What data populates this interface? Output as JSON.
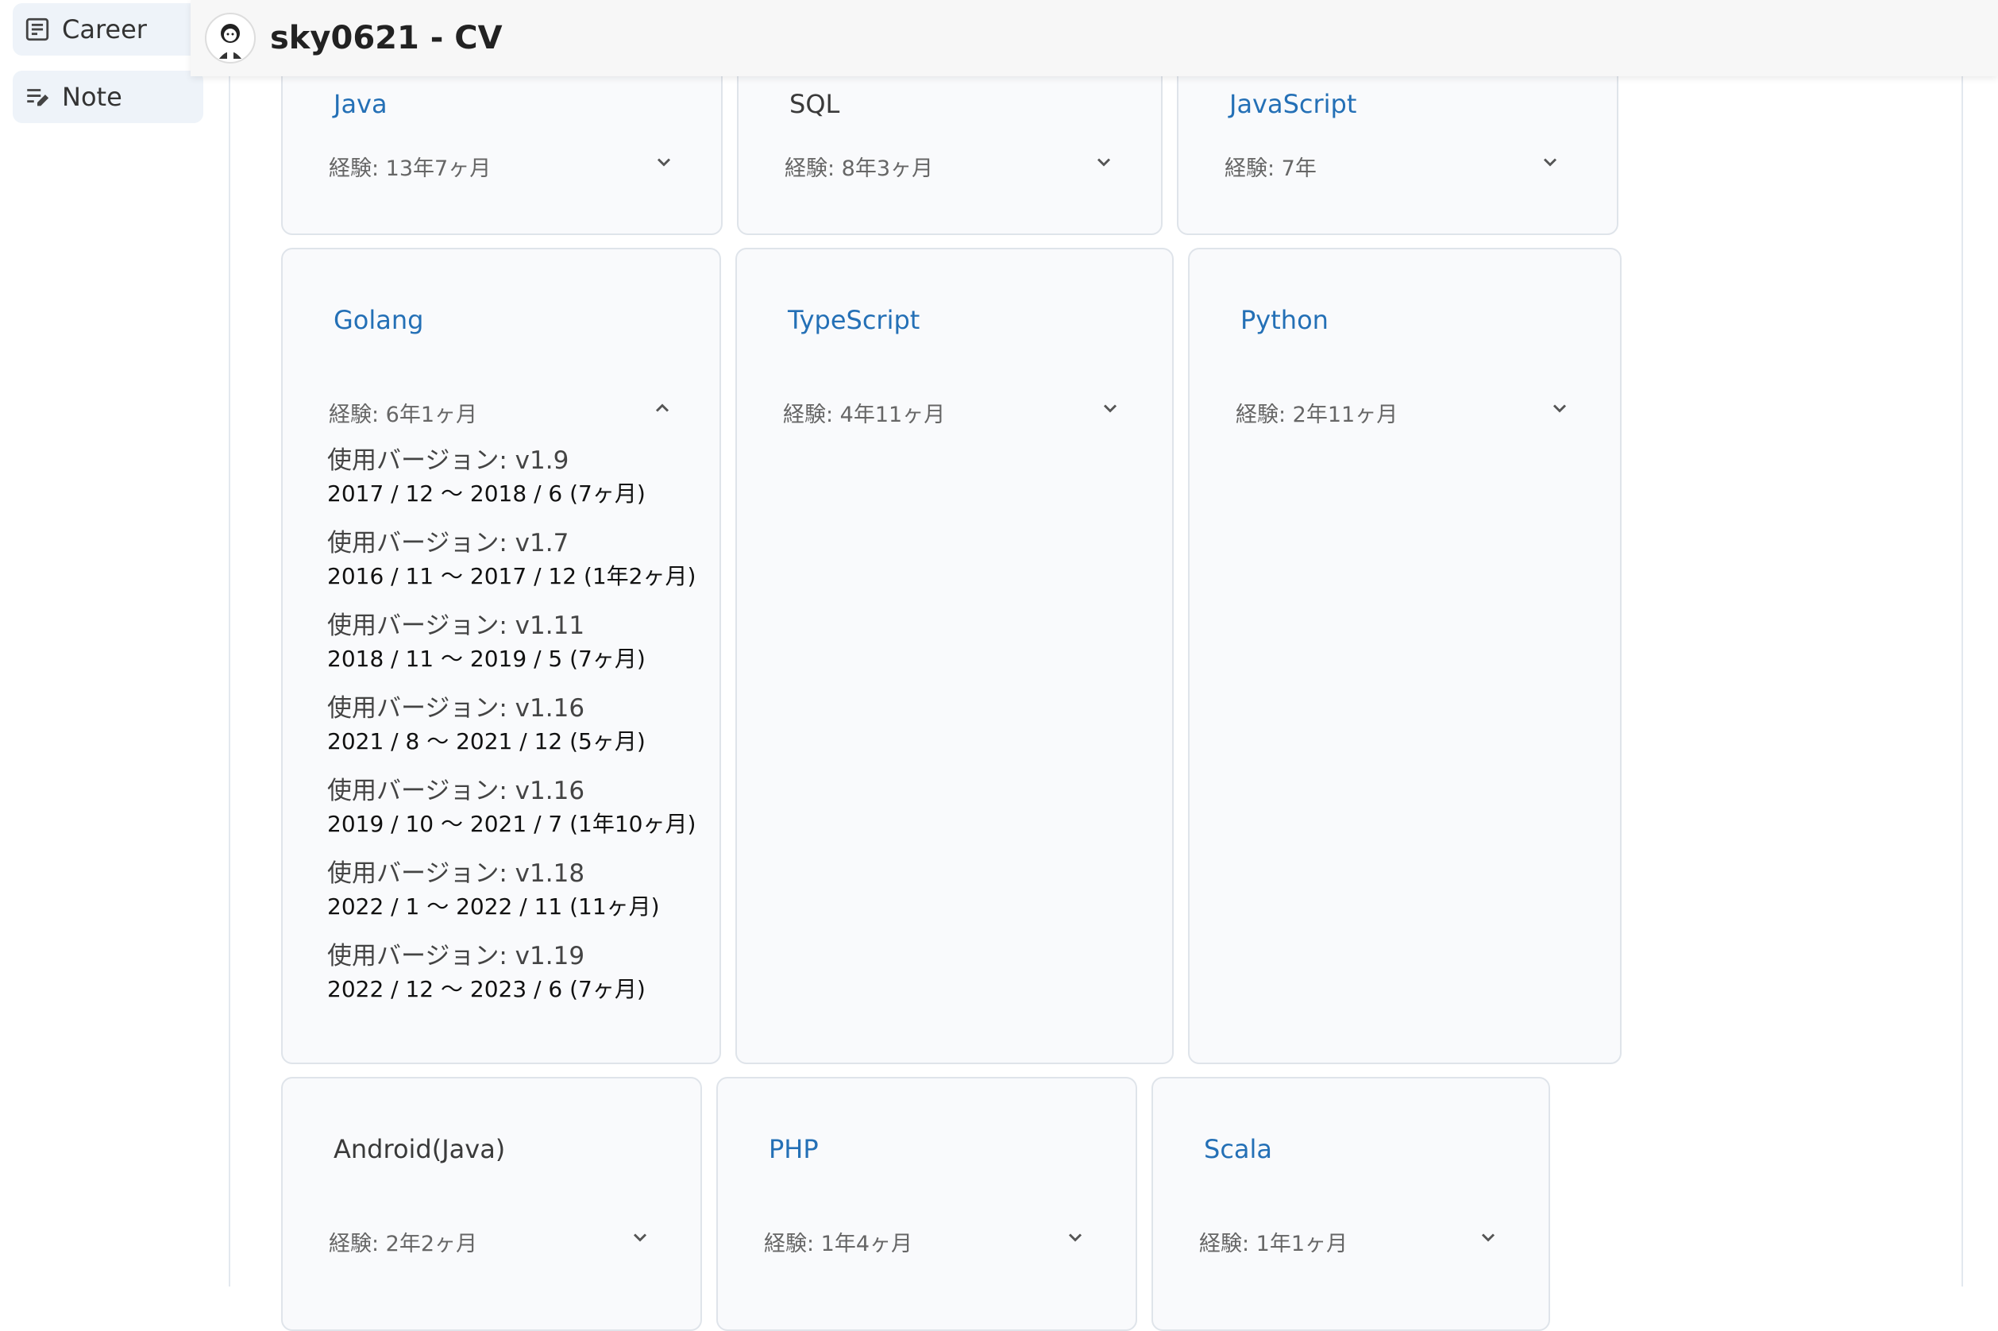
{
  "sidebar": {
    "items": [
      {
        "label": "Career",
        "icon": "career-document-icon"
      },
      {
        "label": "Note",
        "icon": "note-edit-icon"
      }
    ]
  },
  "header": {
    "title": "sky0621 - CV",
    "avatar": "avatar-image"
  },
  "skills": [
    {
      "name": "Java",
      "experience": "経験: 13年7ヶ月",
      "expanded": false
    },
    {
      "name": "SQL",
      "experience": "経験: 8年3ヶ月",
      "expanded": false
    },
    {
      "name": "JavaScript",
      "experience": "経験: 7年",
      "expanded": false
    },
    {
      "name": "Golang",
      "experience": "経験: 6年1ヶ月",
      "expanded": true,
      "versions": [
        {
          "label": "使用バージョン:  v1.9",
          "period": "2017 / 12  ～  2018 / 6  (7ヶ月)"
        },
        {
          "label": "使用バージョン:  v1.7",
          "period": "2016 / 11  ～  2017 / 12  (1年2ヶ月)"
        },
        {
          "label": "使用バージョン:  v1.11",
          "period": "2018 / 11  ～  2019 / 5  (7ヶ月)"
        },
        {
          "label": "使用バージョン:  v1.16",
          "period": "2021 / 8  ～  2021 / 12  (5ヶ月)"
        },
        {
          "label": "使用バージョン:  v1.16",
          "period": "2019 / 10  ～  2021 / 7  (1年10ヶ月)"
        },
        {
          "label": "使用バージョン:  v1.18",
          "period": "2022 / 1  ～  2022 / 11  (11ヶ月)"
        },
        {
          "label": "使用バージョン:  v1.19",
          "period": "2022 / 12  ～  2023 / 6  (7ヶ月)"
        }
      ]
    },
    {
      "name": "TypeScript",
      "experience": "経験: 4年11ヶ月",
      "expanded": false
    },
    {
      "name": "Python",
      "experience": "経験: 2年11ヶ月",
      "expanded": false
    },
    {
      "name": "Android(Java)",
      "experience": "経験: 2年2ヶ月",
      "expanded": false
    },
    {
      "name": "PHP",
      "experience": "経験: 1年4ヶ月",
      "expanded": false
    },
    {
      "name": "Scala",
      "experience": "経験: 1年1ヶ月",
      "expanded": false
    }
  ],
  "colors": {
    "link": "#2470b6",
    "card_bg": "#f9fafc",
    "card_border": "#dfe4ea",
    "nav_bg": "#eef3f9"
  }
}
